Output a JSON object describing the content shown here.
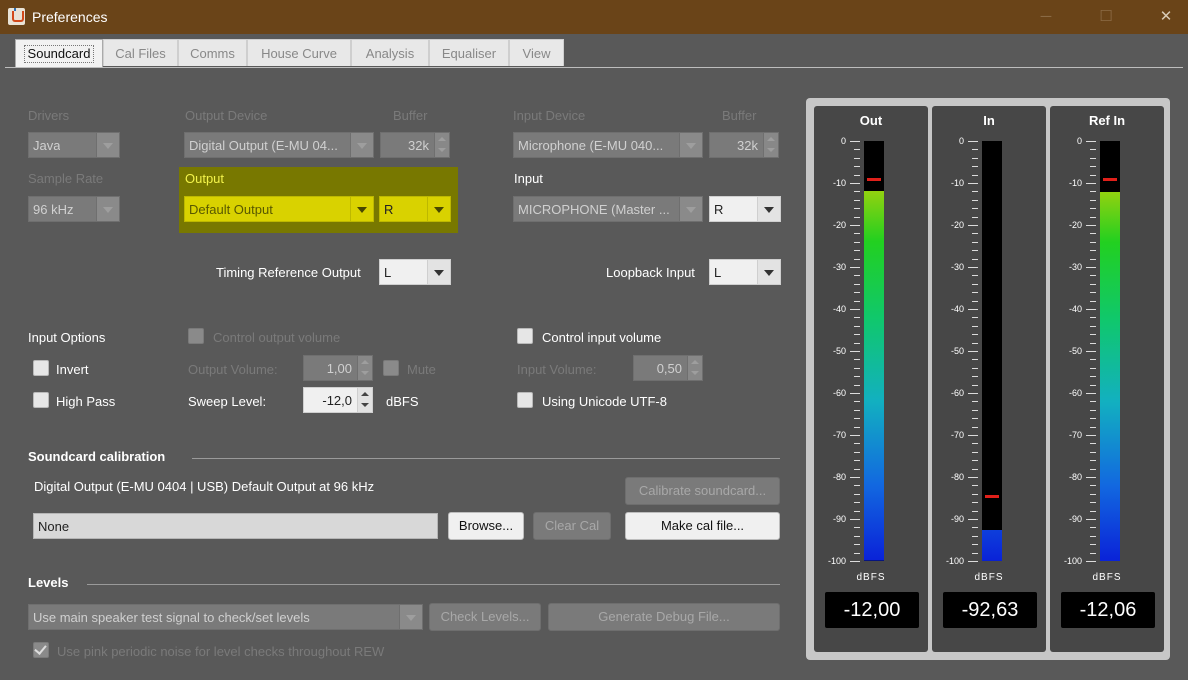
{
  "window": {
    "title": "Preferences",
    "minimize": "─",
    "maximize": "☐",
    "close": "✕"
  },
  "tabs": [
    "Soundcard",
    "Cal Files",
    "Comms",
    "House Curve",
    "Analysis",
    "Equaliser",
    "View"
  ],
  "labels": {
    "drivers": "Drivers",
    "output_device": "Output Device",
    "buffer1": "Buffer",
    "input_device": "Input Device",
    "buffer2": "Buffer",
    "sample_rate": "Sample Rate",
    "output": "Output",
    "input": "Input",
    "timing_ref": "Timing Reference Output",
    "loopback": "Loopback Input",
    "input_options": "Input Options",
    "control_output_volume": "Control output volume",
    "control_input_volume": "Control input volume",
    "invert": "Invert",
    "high_pass": "High Pass",
    "output_volume": "Output Volume:",
    "mute": "Mute",
    "input_volume": "Input Volume:",
    "sweep_level": "Sweep Level:",
    "dbfs": "dBFS",
    "unicode": "Using Unicode UTF-8"
  },
  "values": {
    "drivers": "Java",
    "output_device": "Digital Output (E-MU 04...",
    "buffer1": "32k",
    "input_device": "Microphone (E-MU 040...",
    "buffer2": "32k",
    "sample_rate": "96 kHz",
    "output": "Default Output",
    "output_channel": "R",
    "input": "MICROPHONE (Master ...",
    "input_channel": "R",
    "timing_ref": "L",
    "loopback": "L",
    "output_volume": "1,00",
    "input_volume": "0,50",
    "sweep_level": "-12,0"
  },
  "calibration": {
    "heading": "Soundcard calibration",
    "info": "Digital Output (E-MU 0404 | USB) Default Output at 96 kHz",
    "file": "None",
    "browse": "Browse...",
    "clear": "Clear Cal",
    "calibrate": "Calibrate soundcard...",
    "make": "Make cal file..."
  },
  "levels": {
    "heading": "Levels",
    "mode": "Use main speaker test signal to check/set levels",
    "check": "Check Levels...",
    "debug": "Generate Debug File...",
    "pink": "Use pink periodic noise for level checks throughout REW"
  },
  "meters": {
    "ticks": [
      "0",
      "-10",
      "-20",
      "-30",
      "-40",
      "-50",
      "-60",
      "-70",
      "-80",
      "-90",
      "-100"
    ],
    "unit": "dBFS",
    "items": [
      {
        "name": "Out",
        "value": -12.0,
        "peak": -9,
        "readout": "-12,00"
      },
      {
        "name": "In",
        "value": -92.63,
        "peak": -84.5,
        "readout": "-92,63"
      },
      {
        "name": "Ref In",
        "value": -12.06,
        "peak": -9,
        "readout": "-12,06"
      }
    ]
  }
}
